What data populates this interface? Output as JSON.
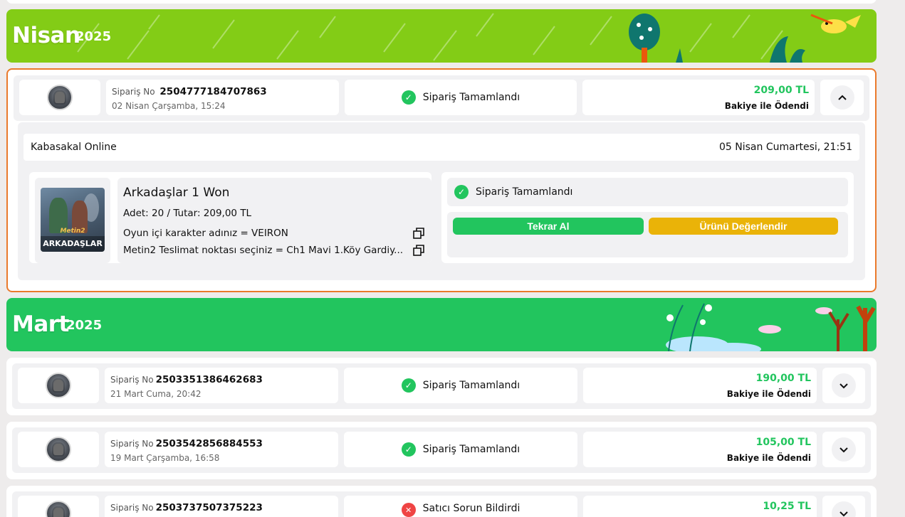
{
  "months": [
    {
      "name": "Nisan",
      "year": "2025",
      "color": "#83cc16"
    },
    {
      "name": "Mart",
      "year": "2025",
      "color": "#22c55e"
    }
  ],
  "order_label": "Sipariş No",
  "expanded_order": {
    "order_no": "2504777184707863",
    "date": "02 Nisan Çarşamba, 15:24",
    "status": "Sipariş Tamamlandı",
    "price": "209,00 TL",
    "payment": "Bakiye ile Ödendi",
    "seller": "Kabasakal Online",
    "delivery_date": "05 Nisan Cumartesi, 21:51",
    "product": {
      "title": "Arkadaşlar 1 Won",
      "qty_line": "Adet: 20  /  Tutar: 209,00 TL",
      "field1": "Oyun içi karakter adınız = VEIRON",
      "field2": "Metin2 Teslimat noktası seçiniz = Ch1 Mavi 1.Köy Gardiy...",
      "image_caption": "ARKADAŞLAR",
      "image_logo": "Metin2"
    },
    "detail_status": "Sipariş Tamamlandı",
    "btn_again": "Tekrar Al",
    "btn_review": "Ürünü Değerlendir"
  },
  "orders": [
    {
      "order_no": "2503351386462683",
      "date": "21 Mart Cuma, 20:42",
      "status": "Sipariş Tamamlandı",
      "price": "190,00 TL",
      "payment": "Bakiye ile Ödendi"
    },
    {
      "order_no": "2503542856884553",
      "date": "19 Mart Çarşamba, 16:58",
      "status": "Sipariş Tamamlandı",
      "price": "105,00 TL",
      "payment": "Bakiye ile Ödendi"
    },
    {
      "order_no": "2503737507375223",
      "date": "",
      "status": "Satıcı Sorun Bildirdi",
      "price": "10,25 TL",
      "payment": ""
    }
  ],
  "colors": {
    "accent_green": "#22c55e",
    "accent_orange": "#ea7a2c",
    "review_yellow": "#eab308",
    "error_red": "#ef4444"
  }
}
